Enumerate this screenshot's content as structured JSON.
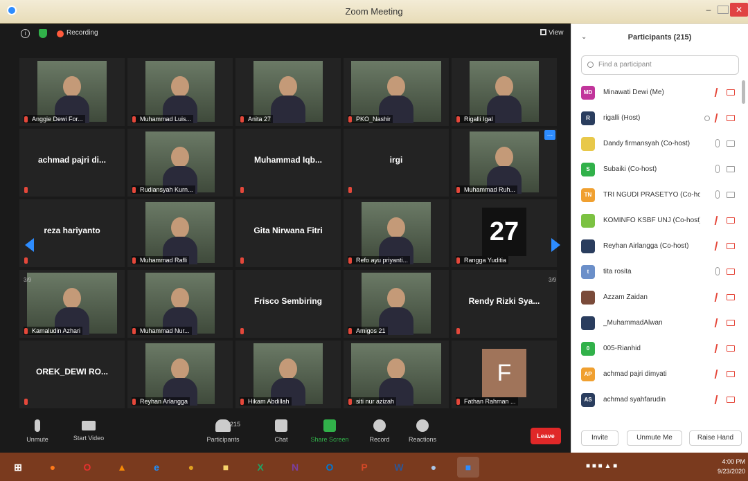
{
  "window": {
    "title": "Zoom Meeting"
  },
  "topbar": {
    "recording": "Recording",
    "view": "View"
  },
  "pages": {
    "left": "3/9",
    "right": "3/9"
  },
  "tiles": [
    {
      "name": "Anggie Dewi For...",
      "video": true
    },
    {
      "name": "Muhammad Luis...",
      "video": true
    },
    {
      "name": "Anita 27",
      "video": true
    },
    {
      "name": "PKO_Nashir",
      "video": true,
      "wide": true
    },
    {
      "name": "Rigalli Igal",
      "video": true
    },
    {
      "center": "achmad pajri di...",
      "video": false
    },
    {
      "name": "Rudiansyah Kurn...",
      "video": true
    },
    {
      "center": "Muhammad Iqb...",
      "video": false
    },
    {
      "center": "irgi",
      "video": false
    },
    {
      "name": "Muhammad Ruh...",
      "video": true,
      "more": true
    },
    {
      "center": "reza hariyanto",
      "video": false
    },
    {
      "name": "Muhammad Rafli",
      "video": true
    },
    {
      "center": "Gita Nirwana Fitri",
      "video": false
    },
    {
      "name": "Refo ayu priyanti...",
      "video": true
    },
    {
      "name": "Rangga Yuditia",
      "jersey": "27"
    },
    {
      "name": "Kamaludin Azhari",
      "video": true,
      "wide": true
    },
    {
      "name": "Muhammad Nur...",
      "video": true
    },
    {
      "center": "Frisco Sembiring",
      "video": false
    },
    {
      "name": "Amigos 21",
      "video": true
    },
    {
      "center": "Rendy Rizki Sya...",
      "video": false
    },
    {
      "center": "OREK_DEWI RO...",
      "video": false
    },
    {
      "name": "Reyhan Arlangga",
      "video": true
    },
    {
      "name": "Hikam Abdillah",
      "video": true
    },
    {
      "name": "siti nur azizah",
      "video": true,
      "wide": true
    },
    {
      "name": "Fathan Rahman ...",
      "letter": "F"
    }
  ],
  "toolbar": {
    "unmute": "Unmute",
    "start_video": "Start Video",
    "participants": "Participants",
    "participants_count": "215",
    "chat": "Chat",
    "share": "Share Screen",
    "record": "Record",
    "reactions": "Reactions",
    "leave": "Leave"
  },
  "panel": {
    "title": "Participants (215)",
    "search_placeholder": "Find a participant",
    "participants": [
      {
        "initials": "MD",
        "color": "#c1359b",
        "name": "Minawati Dewi (Me)",
        "muted": true
      },
      {
        "initials": "R",
        "color": "#2a3d5e",
        "name": "rigalli  (Host)",
        "muted": true,
        "host": true
      },
      {
        "initials": "",
        "color": "#e8c84a",
        "name": "Dandy firmansyah (Co-host)",
        "muted": false
      },
      {
        "initials": "S",
        "color": "#31b14a",
        "name": "Subaiki (Co-host)",
        "muted": false
      },
      {
        "initials": "TN",
        "color": "#f0a030",
        "name": "TRI NGUDI PRASETYO (Co-host)",
        "muted": false
      },
      {
        "initials": "",
        "color": "#7cc242",
        "name": "KOMINFO KSBF UNJ (Co-host)",
        "muted": true
      },
      {
        "initials": "",
        "color": "#2a3d5e",
        "name": "Reyhan Airlangga (Co-host)",
        "muted": true
      },
      {
        "initials": "t",
        "color": "#6b8fc9",
        "name": "tita rosita",
        "muted": true,
        "mic_on": true
      },
      {
        "initials": "",
        "color": "#7a4b3a",
        "name": "Azzam Zaidan",
        "muted": true
      },
      {
        "initials": "",
        "color": "#2a3d5e",
        "name": "_MuhammadAlwan",
        "muted": true
      },
      {
        "initials": "0",
        "color": "#31b14a",
        "name": "005-Rianhid",
        "muted": true
      },
      {
        "initials": "AP",
        "color": "#f0a030",
        "name": "achmad pajri dimyati",
        "muted": true
      },
      {
        "initials": "AS",
        "color": "#2a3d5e",
        "name": "achmad syahfarudin",
        "muted": true
      }
    ],
    "invite": "Invite",
    "unmute_me": "Unmute Me",
    "raise_hand": "Raise Hand"
  },
  "taskbar": {
    "apps": [
      "start",
      "firefox",
      "opera",
      "vlc",
      "ie",
      "chrome",
      "files",
      "excel",
      "onenote",
      "outlook",
      "powerpoint",
      "word",
      "paint",
      "zoom"
    ],
    "time": "4:00 PM",
    "date": "9/23/2020"
  }
}
